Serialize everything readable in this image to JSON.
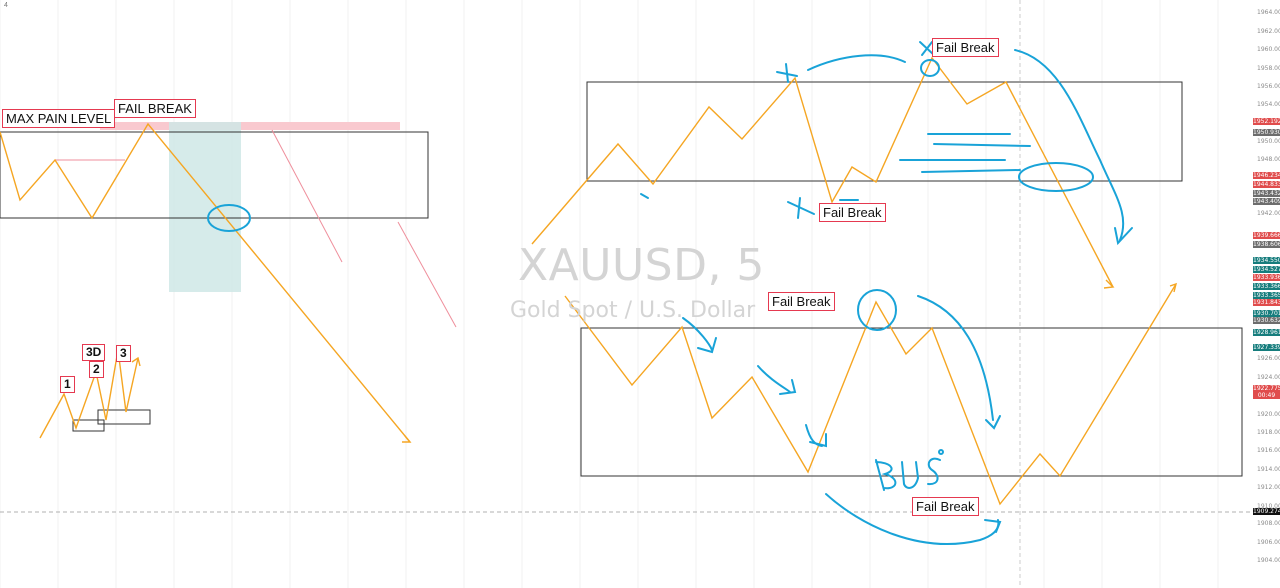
{
  "watermark": {
    "symbol": "XAUUSD, 5",
    "description": "Gold Spot / U.S. Dollar"
  },
  "toolbar": {
    "corner_text": "4"
  },
  "labels": {
    "max_pain": "MAX PAIN LEVEL",
    "fail_break_upper_left": "FAIL BREAK",
    "fail_break_top": "Fail Break",
    "fail_break_mid": "Fail Break",
    "fail_break_lower_left": "Fail Break",
    "fail_break_bottom": "Fail Break",
    "count_1": "1",
    "count_2": "2",
    "count_3d": "3D",
    "count_3": "3",
    "handwriting": "BUS"
  },
  "colors": {
    "price_line": "#f5a623",
    "annotation": "#19a3d8",
    "label_border": "#e53950",
    "zone_fill": "#cfe8e6",
    "pain_fill": "#f9c9cf"
  },
  "chart_data": {
    "type": "line",
    "symbol": "XAUUSD",
    "timeframe": "5",
    "y_axis_ticks": [
      "1964.000",
      "1962.000",
      "1960.000",
      "1958.000",
      "1956.000",
      "1954.000",
      "1950.000",
      "1948.000",
      "1942.000",
      "1926.000",
      "1924.000",
      "1920.000",
      "1918.000",
      "1916.000",
      "1914.000",
      "1912.000",
      "1910.000",
      "1908.000",
      "1906.000",
      "1904.000"
    ],
    "price_tags": [
      {
        "value": "1952.192",
        "color": "#e04c4c"
      },
      {
        "value": "1950.930",
        "color": "#6d6d6d"
      },
      {
        "value": "1946.234",
        "color": "#e04c4c"
      },
      {
        "value": "1944.833",
        "color": "#e04c4c"
      },
      {
        "value": "1943.432",
        "color": "#6d6d6d"
      },
      {
        "value": "1943.409",
        "color": "#6d6d6d"
      },
      {
        "value": "1939.666",
        "color": "#e04c4c"
      },
      {
        "value": "1938.606",
        "color": "#6d6d6d"
      },
      {
        "value": "1934.550",
        "color": "#167d7d"
      },
      {
        "value": "1934.527",
        "color": "#167d7d"
      },
      {
        "value": "1933.936",
        "color": "#e04c4c"
      },
      {
        "value": "1933.366",
        "color": "#167d7d"
      },
      {
        "value": "1933.365",
        "color": "#167d7d"
      },
      {
        "value": "1931.843",
        "color": "#e04c4c"
      },
      {
        "value": "1930.701",
        "color": "#167d7d"
      },
      {
        "value": "1930.632",
        "color": "#6d6d6d"
      },
      {
        "value": "1928.961",
        "color": "#167d7d"
      },
      {
        "value": "1927.339",
        "color": "#167d7d"
      },
      {
        "value": "1922.775",
        "color": "#e04c4c"
      },
      {
        "value": "00:49",
        "color": "#e04c4c"
      },
      {
        "value": "1909.274",
        "color": "#111111"
      }
    ],
    "grid": true,
    "annotations": [
      "MAX PAIN LEVEL",
      "FAIL BREAK",
      "Fail Break",
      "1",
      "2",
      "3D",
      "3",
      "BUS"
    ]
  }
}
